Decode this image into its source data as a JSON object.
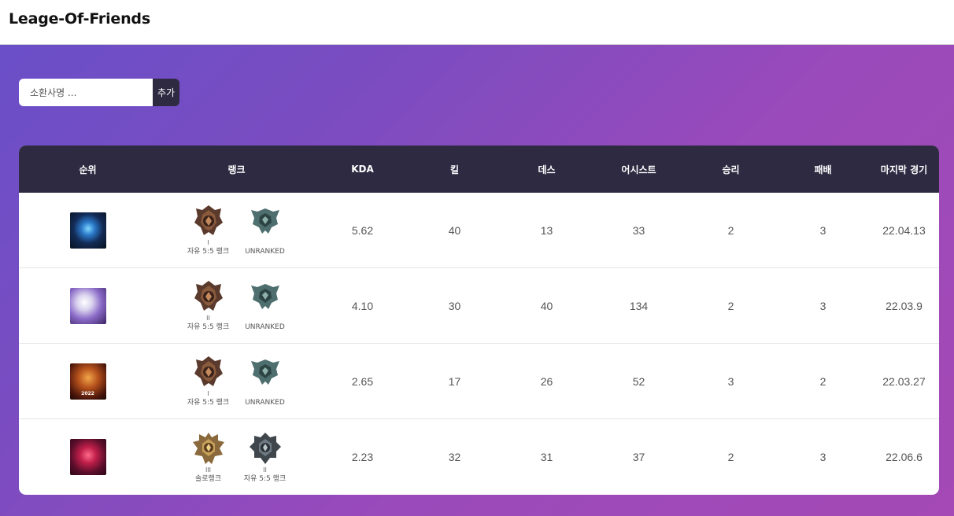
{
  "app": {
    "title": "Leage-Of-Friends"
  },
  "search": {
    "placeholder": "소환사명 ...",
    "add_label": "추가"
  },
  "table": {
    "headers": {
      "rank_no": "순위",
      "rank": "랭크",
      "kda": "KDA",
      "kill": "킬",
      "death": "데스",
      "assist": "어시스트",
      "win": "승리",
      "loss": "패배",
      "last_game": "마지막 경기"
    },
    "rows": [
      {
        "ranks": [
          {
            "tier": "I",
            "queue": "자유 5:5 랭크",
            "emblem": "bronze-emblem-icon"
          },
          {
            "tier": "",
            "queue": "UNRANKED",
            "emblem": "unranked-emblem-icon"
          }
        ],
        "kda": "5.62",
        "kill": "40",
        "death": "13",
        "assist": "33",
        "win": "2",
        "loss": "3",
        "last_game": "22.04.13"
      },
      {
        "ranks": [
          {
            "tier": "II",
            "queue": "자유 5:5 랭크",
            "emblem": "bronze-emblem-icon"
          },
          {
            "tier": "",
            "queue": "UNRANKED",
            "emblem": "unranked-emblem-icon"
          }
        ],
        "kda": "4.10",
        "kill": "30",
        "death": "40",
        "assist": "134",
        "win": "2",
        "loss": "3",
        "last_game": "22.03.9"
      },
      {
        "avatar_caption": "2022",
        "ranks": [
          {
            "tier": "I",
            "queue": "자유 5:5 랭크",
            "emblem": "bronze-emblem-icon"
          },
          {
            "tier": "",
            "queue": "UNRANKED",
            "emblem": "unranked-emblem-icon"
          }
        ],
        "kda": "2.65",
        "kill": "17",
        "death": "26",
        "assist": "52",
        "win": "3",
        "loss": "2",
        "last_game": "22.03.27"
      },
      {
        "ranks": [
          {
            "tier": "III",
            "queue": "솔로랭크",
            "emblem": "gold-emblem-icon"
          },
          {
            "tier": "II",
            "queue": "자유 5:5 랭크",
            "emblem": "silver-emblem-icon"
          }
        ],
        "kda": "2.23",
        "kill": "32",
        "death": "31",
        "assist": "37",
        "win": "2",
        "loss": "3",
        "last_game": "22.06.6"
      }
    ]
  },
  "colors": {
    "header_bg": "#2e2a42",
    "gradient_start": "#6a4fc8",
    "gradient_end": "#a449b5",
    "bronze": "#8a5a3c",
    "unranked": "#4f6f6f",
    "gold": "#b88a3c",
    "silver": "#5e6b73"
  }
}
